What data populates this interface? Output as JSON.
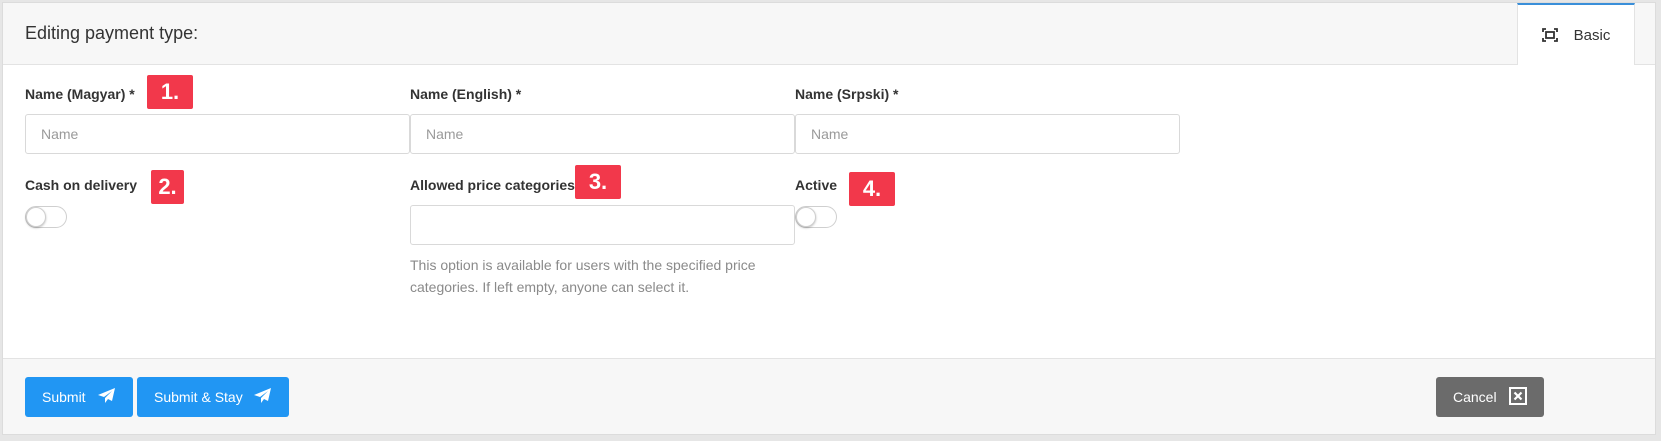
{
  "header": {
    "title": "Editing payment type:",
    "tab": {
      "label": "Basic",
      "icon": "fullscreen-icon"
    }
  },
  "form": {
    "name_magyar": {
      "label": "Name (Magyar) *",
      "placeholder": "Name",
      "value": ""
    },
    "name_english": {
      "label": "Name (English) *",
      "placeholder": "Name",
      "value": ""
    },
    "name_srpski": {
      "label": "Name (Srpski) *",
      "placeholder": "Name",
      "value": ""
    },
    "cash_on_delivery": {
      "label": "Cash on delivery",
      "checked": false
    },
    "price_categories": {
      "label": "Allowed price categories",
      "value": "",
      "help": "This option is available for users with the specified price categories. If left empty, anyone can select it."
    },
    "active": {
      "label": "Active",
      "checked": false
    }
  },
  "badges": [
    "1.",
    "2.",
    "3.",
    "4."
  ],
  "footer": {
    "submit_label": "Submit",
    "submit_stay_label": "Submit & Stay",
    "cancel_label": "Cancel",
    "submit_icon": "paper-plane-icon",
    "cancel_icon": "close-box-icon"
  },
  "colors": {
    "primary": "#2196f3",
    "badge": "#f2384b",
    "cancel": "#6b6b6b",
    "tab_accent": "#3a8fd9"
  }
}
